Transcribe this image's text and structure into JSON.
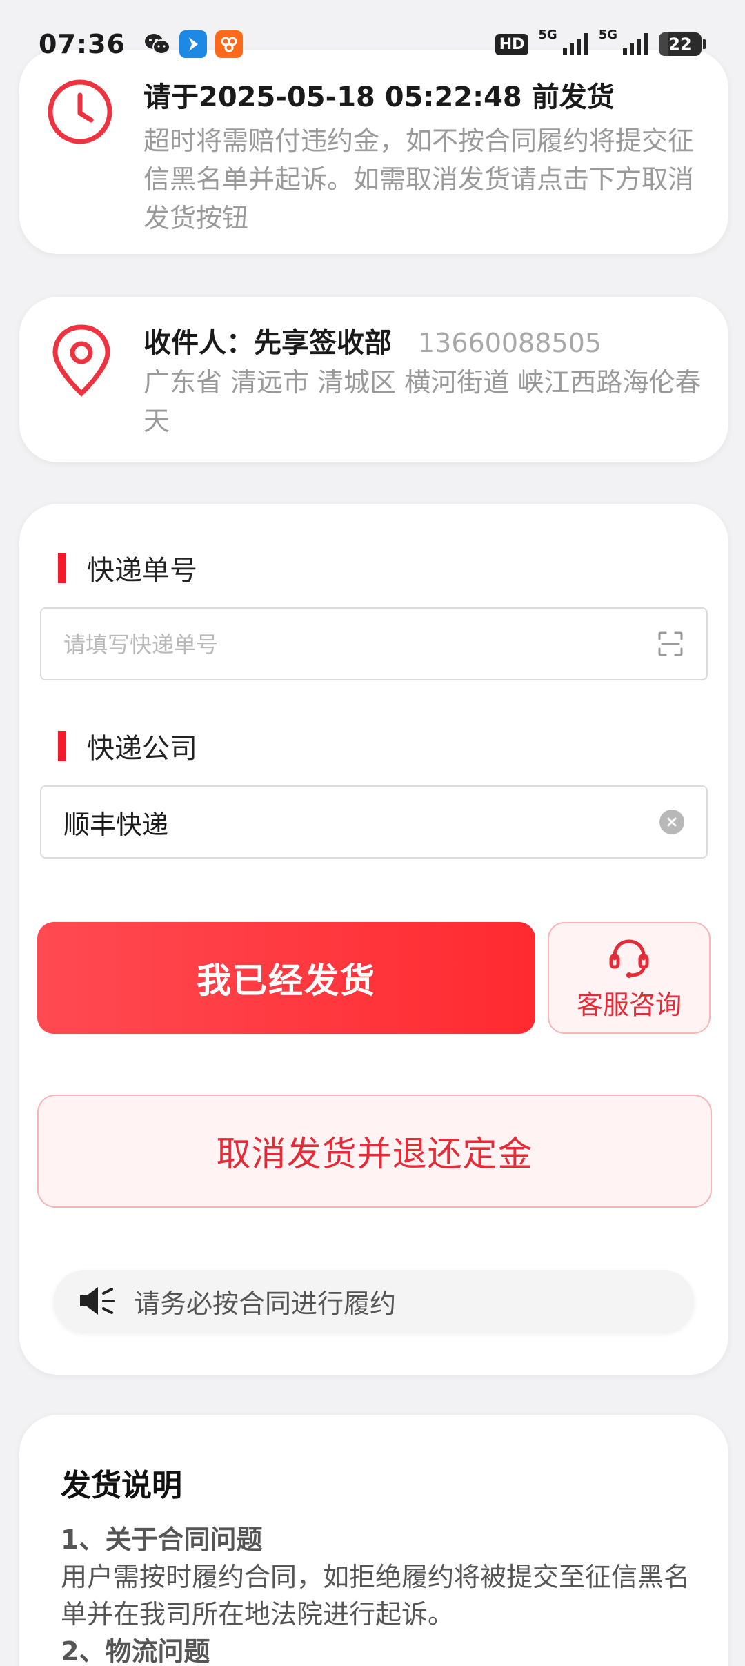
{
  "status_bar": {
    "time": "07:36",
    "hd": "HD",
    "net1": "5G",
    "net2": "5G",
    "battery": "22",
    "battery_level": 0.22,
    "icons": [
      "wechat-icon",
      "blue-app-icon",
      "orange-app-icon",
      "signal-icon",
      "battery-icon"
    ]
  },
  "deadline": {
    "title": "请于2025-05-18 05:22:48 前发货",
    "desc": "超时将需赔付违约金，如不按合同履约将提交征信黑名单并起诉。如需取消发货请点击下方取消发货按钮",
    "icon": "clock-icon",
    "accent": "#ee3340"
  },
  "recipient": {
    "label": "收件人：",
    "name": "先享签收部",
    "phone": "13660088505",
    "address": "广东省 清远市 清城区 横河街道 峡江西路海伦春天",
    "icon": "location-pin-icon"
  },
  "form": {
    "tracking_label": "快递单号",
    "tracking_placeholder": "请填写快递单号",
    "company_label": "快递公司",
    "company_value": "顺丰快递",
    "shipped_button": "我已经发货",
    "service_button": "客服咨询",
    "cancel_button": "取消发货并退还定金",
    "notice": "请务必按合同进行履约",
    "brand_color": "#ff2a30"
  },
  "notes": {
    "title": "发货说明",
    "item1_title": "1、关于合同问题",
    "item1_body": "用户需按时履约合同，如拒绝履约将被提交至征信黑名单并在我司所在地法院进行起诉。",
    "item2_title": "2、物流问题"
  }
}
